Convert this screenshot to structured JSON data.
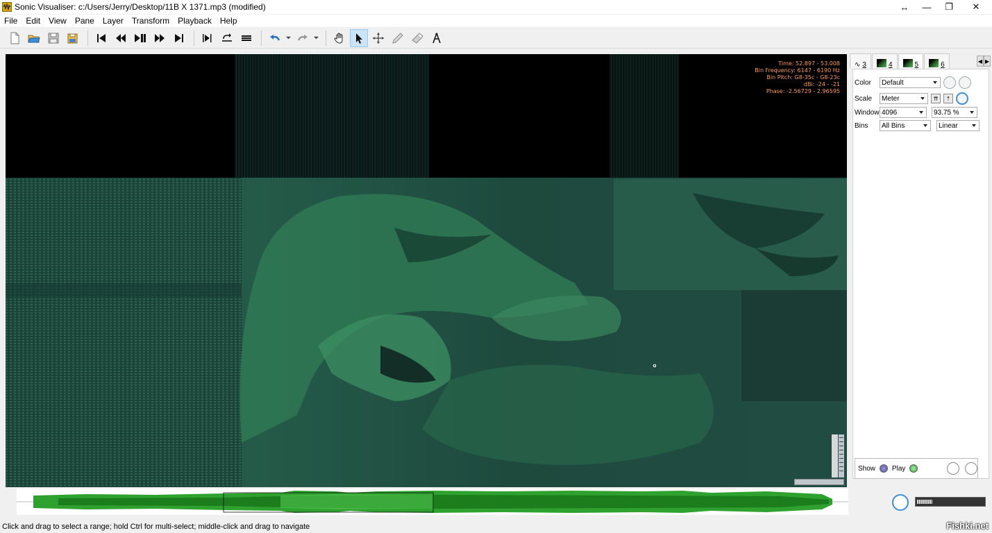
{
  "window": {
    "title": "Sonic Visualiser: c:/Users/Jerry/Desktop/11B X 1371.mp3 (modified)",
    "controls": [
      "↔",
      "—",
      "❐",
      "✕"
    ]
  },
  "menu": [
    "File",
    "Edit",
    "View",
    "Pane",
    "Layer",
    "Transform",
    "Playback",
    "Help"
  ],
  "toolbar": {
    "file_icons": [
      "new-file-icon",
      "open-folder-icon",
      "save-icon",
      "save-session-icon"
    ],
    "transport_icons": [
      "rewind-start-icon",
      "rewind-icon",
      "play-pause-icon",
      "fast-forward-icon",
      "ffwd-end-icon"
    ],
    "selection_icons": [
      "play-selection-icon",
      "loop-icon",
      "solo-icon"
    ],
    "edit_icons": [
      "undo-icon",
      "redo-icon"
    ],
    "tool_icons": [
      "navigate-hand-icon",
      "select-arrow-icon",
      "move-icon",
      "draw-pencil-icon",
      "erase-icon",
      "measure-icon"
    ],
    "active_tool": "select-arrow-icon"
  },
  "overlay": {
    "time": "Time: 52.897 - 53.008",
    "bin_frequency": "Bin Frequency: 6147 - 6190 Hz",
    "bin_pitch": "Bin Pitch: G8-35c - G8-23c",
    "dbi": "dBi: -24 - -21",
    "phase": "Phase: -2.56729 - 2.96595"
  },
  "tabs": [
    {
      "label": "3",
      "icon": "waveform-icon"
    },
    {
      "label": "4",
      "icon": "spectrogram-icon"
    },
    {
      "label": "5",
      "icon": "spectrogram-icon",
      "active": true
    },
    {
      "label": "6",
      "icon": "spectrogram-icon"
    }
  ],
  "properties": {
    "color_label": "Color",
    "color_value": "Default",
    "scale_label": "Scale",
    "scale_value": "Meter",
    "window_label": "Window",
    "window_value": "4096",
    "overlap_value": "93.75 %",
    "bins_label": "Bins",
    "bins_value": "All Bins",
    "bins_scale_value": "Linear"
  },
  "show_play": {
    "show_label": "Show",
    "play_label": "Play"
  },
  "status": "Click and drag to select a range; hold Ctrl for multi-select; middle-click and drag to navigate",
  "watermark": "Fishki.net",
  "colors": {
    "accent_blue": "#3a8fd8",
    "spectrogram_green": "#2f7a55",
    "overlay_text": "#ff9a50",
    "waveform_green": "#2ea12e"
  }
}
